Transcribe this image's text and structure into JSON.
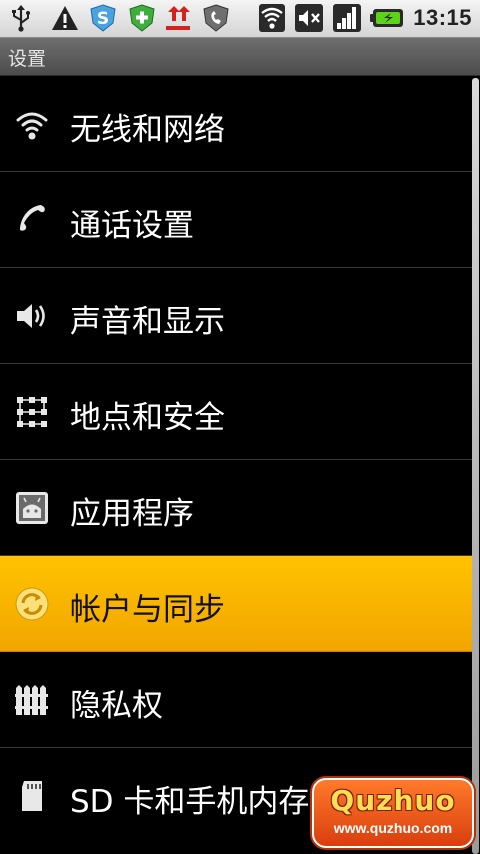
{
  "status_bar": {
    "time": "13:15",
    "icons": [
      "usb-icon",
      "warning-icon",
      "shield-s-icon",
      "plus-shield-icon",
      "upload-icon",
      "phone-shield-icon",
      "wifi-icon",
      "mute-icon",
      "signal-icon",
      "battery-icon"
    ]
  },
  "title_bar": {
    "title": "设置"
  },
  "settings": {
    "items": [
      {
        "label": "无线和网络",
        "icon": "wifi-icon"
      },
      {
        "label": "通话设置",
        "icon": "phone-icon"
      },
      {
        "label": "声音和显示",
        "icon": "speaker-icon"
      },
      {
        "label": "地点和安全",
        "icon": "pattern-lock-icon"
      },
      {
        "label": "应用程序",
        "icon": "app-icon"
      },
      {
        "label": "帐户与同步",
        "icon": "sync-icon"
      },
      {
        "label": "隐私权",
        "icon": "fence-icon"
      },
      {
        "label": "SD 卡和手机内存",
        "icon": "sd-card-icon"
      }
    ],
    "selected_index": 5
  },
  "watermark": {
    "brand": "Quzhuo",
    "url": "www.quzhuo.com"
  },
  "colors": {
    "highlight": "#f7b500",
    "background": "#000000"
  }
}
